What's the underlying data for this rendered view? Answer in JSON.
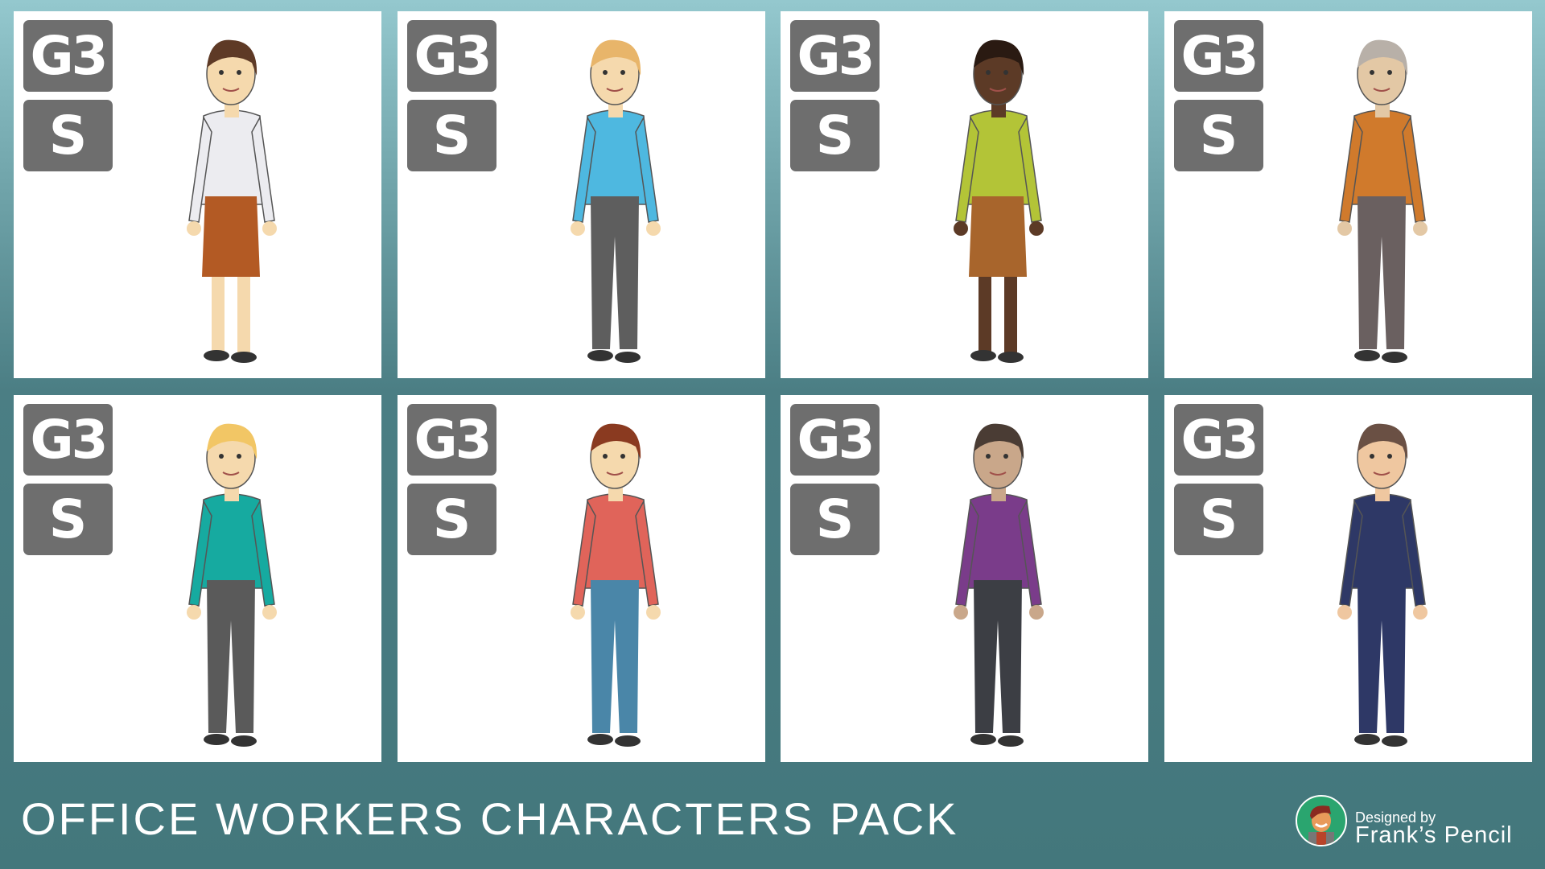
{
  "title": "OFFICE WORKERS CHARACTERS PACK",
  "credit": {
    "line1": "Designed by",
    "line2": "Frank’s Pencil"
  },
  "cards": [
    {
      "badge1": "G3",
      "badge2": "S",
      "hair": "#5e3a26",
      "skin": "#f5d9ad",
      "top": "#ececf0",
      "bottom": "#b35a24",
      "legs": "#f5d9ad",
      "skirt": true
    },
    {
      "badge1": "G3",
      "badge2": "S",
      "hair": "#e8b56a",
      "skin": "#f5d9ad",
      "top": "#4eb8e0",
      "bottom": "#5e5e5e",
      "legs": "#5e5e5e",
      "skirt": false
    },
    {
      "badge1": "G3",
      "badge2": "S",
      "hair": "#2a1a12",
      "skin": "#5c3a26",
      "top": "#b3c437",
      "bottom": "#a8652c",
      "legs": "#5c3a26",
      "skirt": true
    },
    {
      "badge1": "G3",
      "badge2": "S",
      "hair": "#b8b0a8",
      "skin": "#e3c8a5",
      "top": "#d07a2c",
      "bottom": "#6a6060",
      "legs": "#6a6060",
      "skirt": false
    },
    {
      "badge1": "G3",
      "badge2": "S",
      "hair": "#f2c665",
      "skin": "#f5d9ad",
      "top": "#16aaa0",
      "bottom": "#5a5a5a",
      "legs": "#5a5a5a",
      "skirt": false
    },
    {
      "badge1": "G3",
      "badge2": "S",
      "hair": "#8a3a20",
      "skin": "#f5d9ad",
      "top": "#e0645a",
      "bottom": "#4a86a8",
      "legs": "#4a86a8",
      "skirt": false
    },
    {
      "badge1": "G3",
      "badge2": "S",
      "hair": "#4a3c34",
      "skin": "#c9a78a",
      "top": "#7a3c8a",
      "bottom": "#3c3e44",
      "legs": "#3c3e44",
      "skirt": false
    },
    {
      "badge1": "G3",
      "badge2": "S",
      "hair": "#6a5044",
      "skin": "#efc7a0",
      "top": "#2e3866",
      "bottom": "#2e3866",
      "legs": "#2e3866",
      "skirt": false
    }
  ]
}
